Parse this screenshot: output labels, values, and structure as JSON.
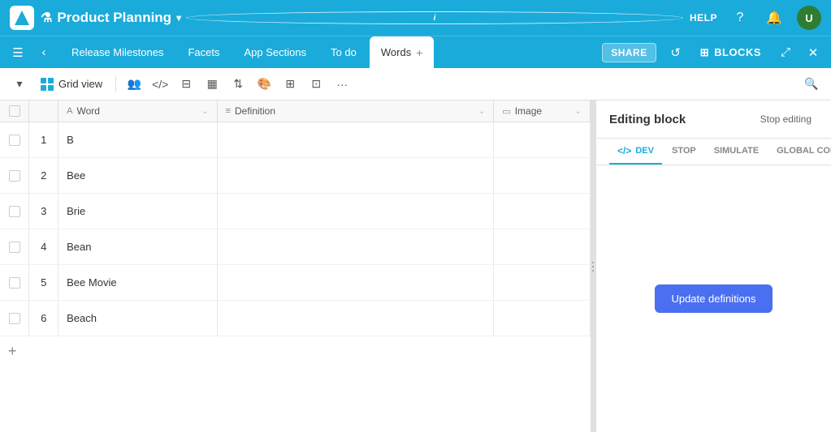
{
  "topbar": {
    "title": "Product Planning",
    "flask_icon": "⚗",
    "chevron": "▾",
    "info": "i",
    "help_label": "HELP",
    "avatar_letter": "U"
  },
  "navbar": {
    "tabs": [
      {
        "id": "release",
        "label": "Release Milestones",
        "active": false
      },
      {
        "id": "facets",
        "label": "Facets",
        "active": false
      },
      {
        "id": "app-sections",
        "label": "App Sections",
        "active": false
      },
      {
        "id": "todo",
        "label": "To do",
        "active": false
      },
      {
        "id": "words",
        "label": "Words",
        "active": true
      }
    ],
    "share_label": "SHARE",
    "blocks_label": "BLOCKS"
  },
  "toolbar": {
    "grid_view_label": "Grid view"
  },
  "grid": {
    "columns": [
      {
        "id": "word",
        "label": "Word",
        "icon": "A"
      },
      {
        "id": "definition",
        "label": "Definition",
        "icon": "≡"
      },
      {
        "id": "image",
        "label": "Image",
        "icon": "▭"
      }
    ],
    "rows": [
      {
        "num": 1,
        "word": "B",
        "definition": "",
        "image": ""
      },
      {
        "num": 2,
        "word": "Bee",
        "definition": "",
        "image": ""
      },
      {
        "num": 3,
        "word": "Brie",
        "definition": "",
        "image": ""
      },
      {
        "num": 4,
        "word": "Bean",
        "definition": "",
        "image": ""
      },
      {
        "num": 5,
        "word": "Bee Movie",
        "definition": "",
        "image": ""
      },
      {
        "num": 6,
        "word": "Beach",
        "definition": "",
        "image": ""
      }
    ],
    "add_label": "+"
  },
  "edit_panel": {
    "title": "Editing block",
    "stop_editing_label": "Stop editing",
    "tabs": [
      {
        "id": "dev",
        "label": "DEV",
        "icon": "<>",
        "active": true
      },
      {
        "id": "stop",
        "label": "STOP",
        "active": false
      },
      {
        "id": "simulate",
        "label": "SIMULATE",
        "active": false
      },
      {
        "id": "global-config",
        "label": "GLOBAL CONFIG",
        "active": false
      }
    ],
    "update_button_label": "Update definitions"
  }
}
